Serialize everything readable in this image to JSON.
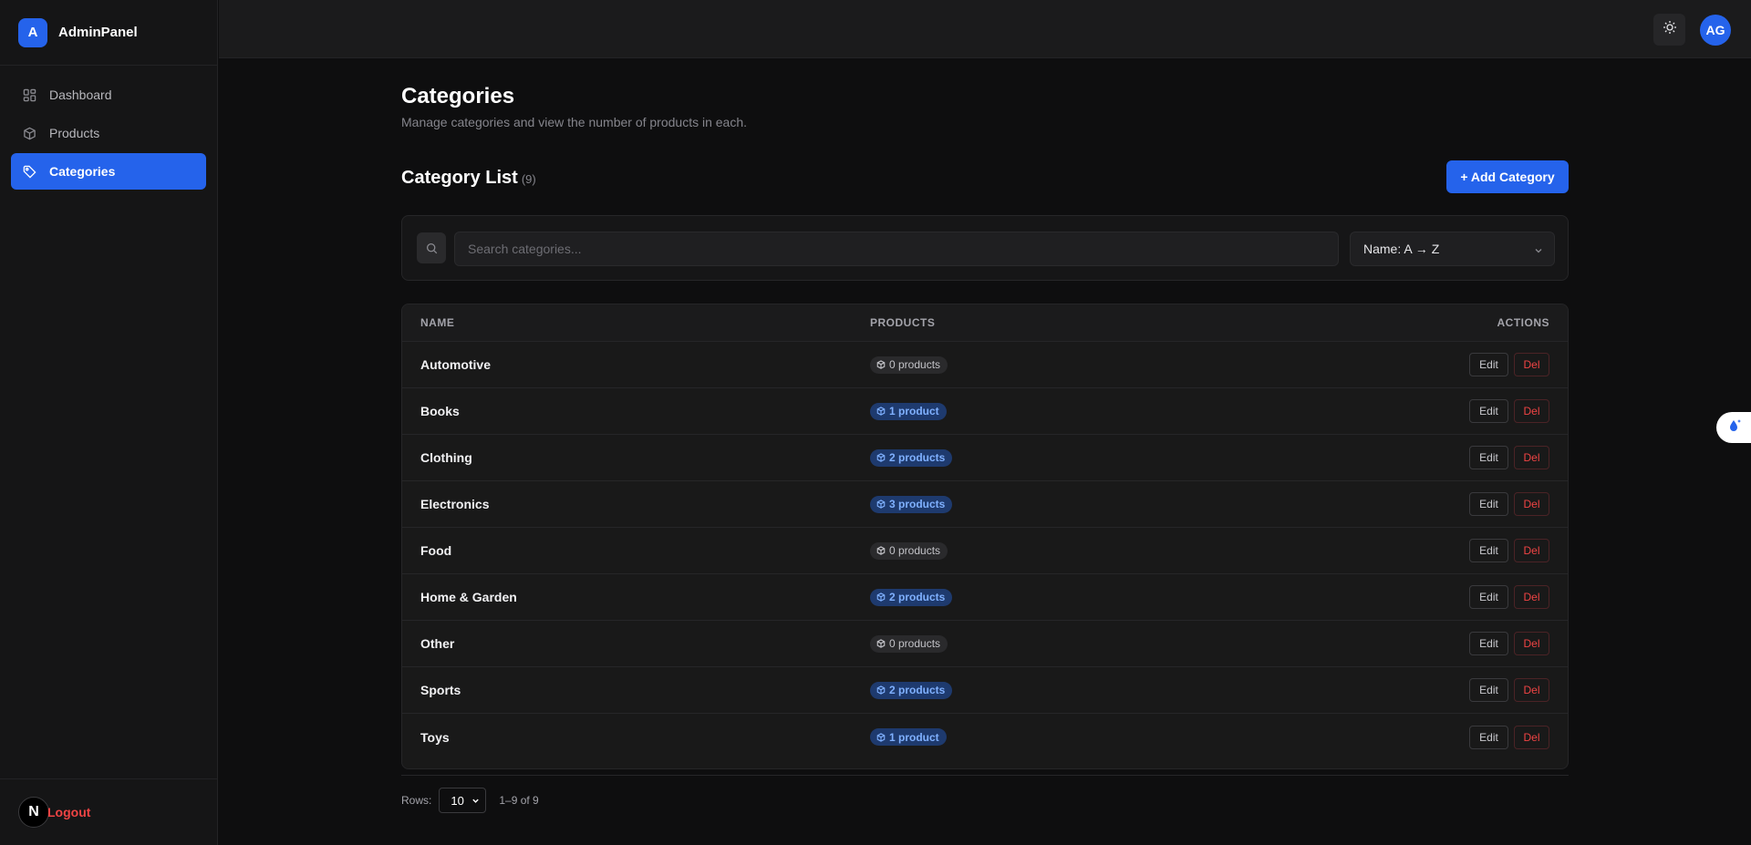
{
  "brand": {
    "logo_letter": "A",
    "name": "AdminPanel"
  },
  "sidebar": {
    "items": [
      {
        "label": "Dashboard",
        "icon": "dashboard-grid-icon"
      },
      {
        "label": "Products",
        "icon": "box-icon"
      },
      {
        "label": "Categories",
        "icon": "tag-icon",
        "active": true
      }
    ],
    "footer": {
      "badge": "N",
      "logout_label": "Logout"
    }
  },
  "topbar": {
    "theme_toggle_icon": "sun-icon",
    "avatar_initials": "AG"
  },
  "page": {
    "title": "Categories",
    "subtitle": "Manage categories and view the number of products in each."
  },
  "list": {
    "title": "Category List",
    "count": "(9)",
    "add_button": "+ Add Category"
  },
  "filters": {
    "search_placeholder": "Search categories...",
    "sort_value": "Name: A → Z"
  },
  "table": {
    "headers": {
      "name": "NAME",
      "products": "PRODUCTS",
      "actions": "ACTIONS"
    },
    "rows": [
      {
        "name": "Automotive",
        "products": "0 products",
        "has": false
      },
      {
        "name": "Books",
        "products": "1 product",
        "has": true
      },
      {
        "name": "Clothing",
        "products": "2 products",
        "has": true
      },
      {
        "name": "Electronics",
        "products": "3 products",
        "has": true
      },
      {
        "name": "Food",
        "products": "0 products",
        "has": false
      },
      {
        "name": "Home & Garden",
        "products": "2 products",
        "has": true
      },
      {
        "name": "Other",
        "products": "0 products",
        "has": false
      },
      {
        "name": "Sports",
        "products": "2 products",
        "has": true
      },
      {
        "name": "Toys",
        "products": "1 product",
        "has": true
      }
    ],
    "edit_label": "Edit",
    "delete_label": "Del"
  },
  "pagination": {
    "rows_label": "Rows:",
    "rows_value": "10",
    "range": "1–9 of 9"
  },
  "colors": {
    "accent": "#2563eb",
    "danger": "#ef4444",
    "background": "#0e0e0f"
  }
}
